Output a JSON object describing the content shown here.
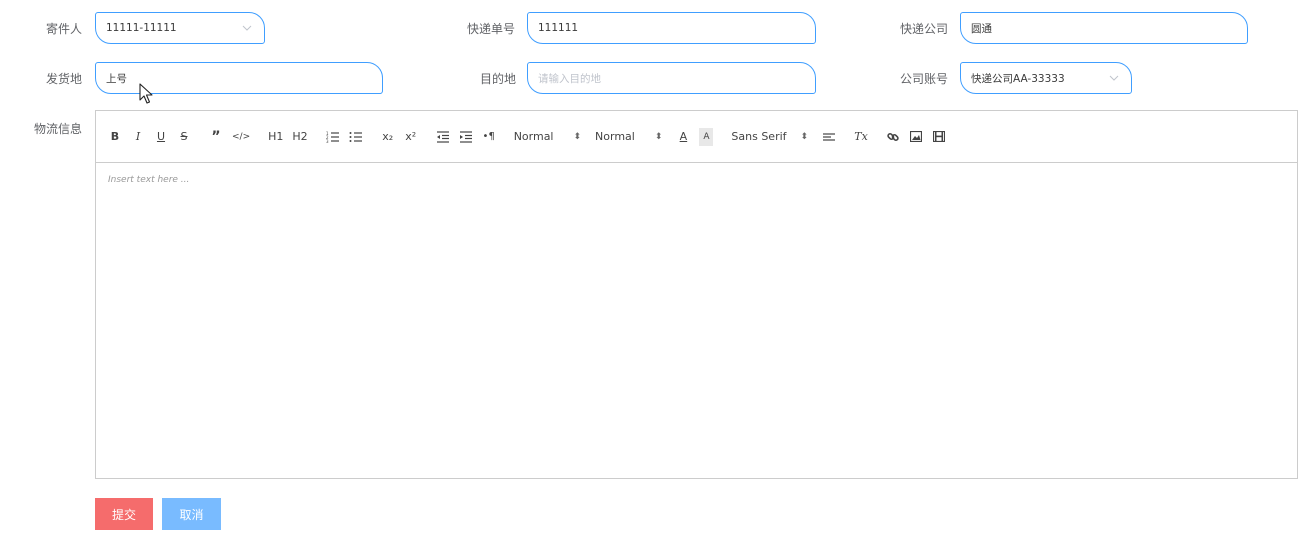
{
  "form": {
    "sender": {
      "label": "寄件人",
      "value": "11111-11111",
      "icon": "chevron-down-icon"
    },
    "tracking_no": {
      "label": "快递单号",
      "value": "111111"
    },
    "courier": {
      "label": "快递公司",
      "value": "圆通"
    },
    "origin": {
      "label": "发货地",
      "value": "上号"
    },
    "destination": {
      "label": "目的地",
      "placeholder": "请输入目的地"
    },
    "account": {
      "label": "公司账号",
      "value": "快递公司AA-33333",
      "icon": "chevron-down-icon"
    },
    "logistics": {
      "label": "物流信息"
    }
  },
  "editor": {
    "toolbar": {
      "bold": "B",
      "italic": "I",
      "underline": "U",
      "strike": "S",
      "blockquote": "”",
      "code": "</>",
      "h1": "H1",
      "h2": "H2",
      "ordered_list": "ordered-list-icon",
      "bullet_list": "bullet-list-icon",
      "subscript": "x₂",
      "superscript": "x²",
      "outdent": "outdent-icon",
      "indent": "indent-icon",
      "direction": "•¶",
      "size_picker": "Normal",
      "header_picker": "Normal",
      "font_color": "A",
      "background_color": "A",
      "font_picker": "Sans Serif",
      "align": "align-icon",
      "clean": "Tx",
      "link": "link-icon",
      "image": "image-icon",
      "video": "video-icon"
    },
    "placeholder": "Insert text here ..."
  },
  "buttons": {
    "submit": "提交",
    "cancel": "取消"
  },
  "colors": {
    "accent": "#409eff",
    "submit": "#f56c6c",
    "cancel": "#79bbff"
  }
}
